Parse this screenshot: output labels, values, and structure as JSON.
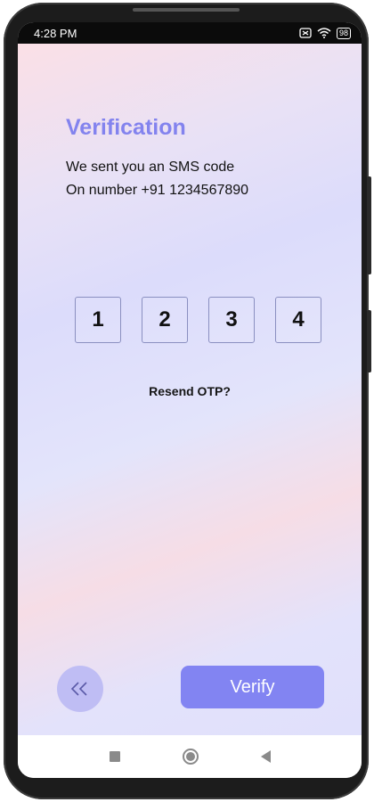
{
  "status_bar": {
    "time": "4:28 PM",
    "battery": "98",
    "icons": [
      "sim-off-icon",
      "wifi-icon",
      "battery-icon"
    ]
  },
  "screen": {
    "title": "Verification",
    "subtitle_line1": "We sent you an SMS code",
    "subtitle_line2": "On number +91 1234567890",
    "otp_digits": [
      "1",
      "2",
      "3",
      "4"
    ],
    "resend_label": "Resend OTP?",
    "back_icon": "double-chevron-left-icon",
    "verify_label": "Verify"
  },
  "nav_bar": {
    "icons": [
      "recents-square-icon",
      "home-circle-icon",
      "back-triangle-icon"
    ]
  },
  "colors": {
    "accent": "#8383ee",
    "button": "#8284f2",
    "back_button": "#bfbdf4",
    "otp_border": "#8a8fc0"
  }
}
